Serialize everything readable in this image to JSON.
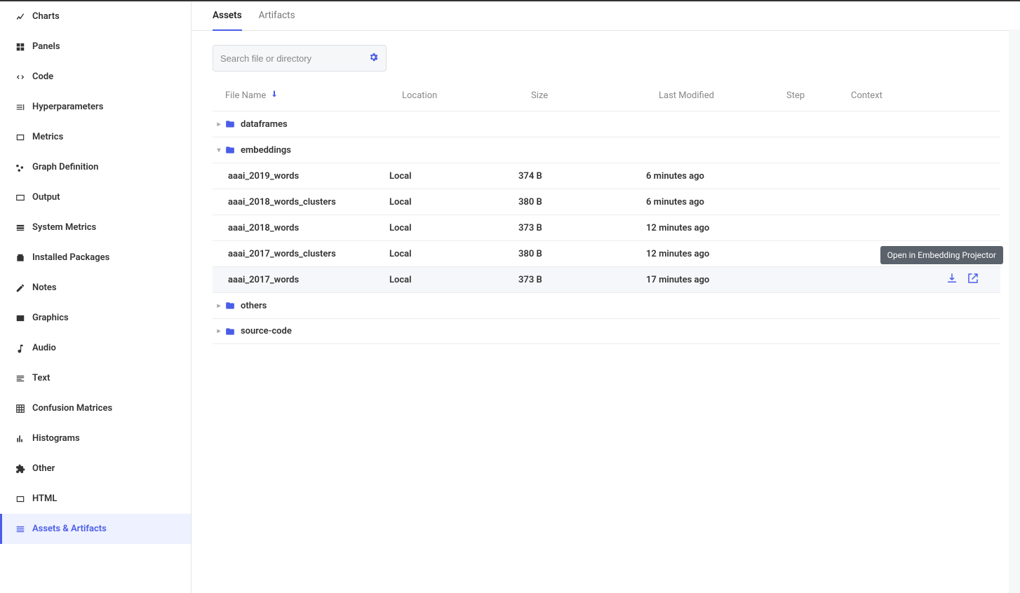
{
  "sidebar": {
    "items": [
      {
        "id": "charts",
        "label": "Charts"
      },
      {
        "id": "panels",
        "label": "Panels"
      },
      {
        "id": "code",
        "label": "Code"
      },
      {
        "id": "hyperparameters",
        "label": "Hyperparameters"
      },
      {
        "id": "metrics",
        "label": "Metrics"
      },
      {
        "id": "graph-definition",
        "label": "Graph Definition"
      },
      {
        "id": "output",
        "label": "Output"
      },
      {
        "id": "system-metrics",
        "label": "System Metrics"
      },
      {
        "id": "installed-packages",
        "label": "Installed Packages"
      },
      {
        "id": "notes",
        "label": "Notes"
      },
      {
        "id": "graphics",
        "label": "Graphics"
      },
      {
        "id": "audio",
        "label": "Audio"
      },
      {
        "id": "text",
        "label": "Text"
      },
      {
        "id": "confusion-matrices",
        "label": "Confusion Matrices"
      },
      {
        "id": "histograms",
        "label": "Histograms"
      },
      {
        "id": "other",
        "label": "Other"
      },
      {
        "id": "html",
        "label": "HTML"
      },
      {
        "id": "assets-artifacts",
        "label": "Assets & Artifacts",
        "active": true
      }
    ]
  },
  "tabs": [
    {
      "id": "assets",
      "label": "Assets",
      "active": true
    },
    {
      "id": "artifacts",
      "label": "Artifacts"
    }
  ],
  "search": {
    "placeholder": "Search file or directory"
  },
  "columns": {
    "file_name": "File Name",
    "location": "Location",
    "size": "Size",
    "last_modified": "Last Modified",
    "step": "Step",
    "context": "Context"
  },
  "rows": [
    {
      "type": "folder",
      "expanded": false,
      "name": "dataframes"
    },
    {
      "type": "folder",
      "expanded": true,
      "name": "embeddings"
    },
    {
      "type": "file",
      "name": "aaai_2019_words",
      "location": "Local",
      "size": "374 B",
      "modified": "6 minutes ago"
    },
    {
      "type": "file",
      "name": "aaai_2018_words_clusters",
      "location": "Local",
      "size": "380 B",
      "modified": "6 minutes ago"
    },
    {
      "type": "file",
      "name": "aaai_2018_words",
      "location": "Local",
      "size": "373 B",
      "modified": "12 minutes ago"
    },
    {
      "type": "file",
      "name": "aaai_2017_words_clusters",
      "location": "Local",
      "size": "380 B",
      "modified": "12 minutes ago"
    },
    {
      "type": "file",
      "name": "aaai_2017_words",
      "location": "Local",
      "size": "373 B",
      "modified": "17 minutes ago",
      "hovered": true,
      "actions": true
    },
    {
      "type": "folder",
      "expanded": false,
      "name": "others"
    },
    {
      "type": "folder",
      "expanded": false,
      "name": "source-code"
    }
  ],
  "tooltip": "Open in Embedding Projector"
}
